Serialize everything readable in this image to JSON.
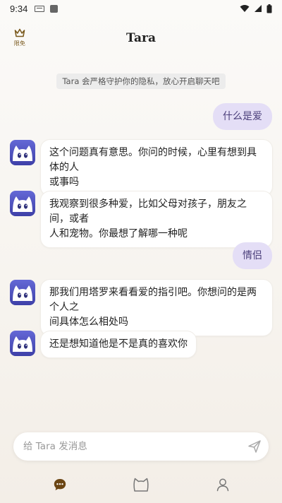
{
  "status_bar": {
    "time": "9:34"
  },
  "header": {
    "vip_label": "限免",
    "title": "Tara"
  },
  "privacy_notice": "Tara 会严格守护你的隐私，放心开启聊天吧",
  "messages": [
    {
      "role": "user",
      "text": "什么是爱"
    },
    {
      "role": "bot",
      "lines": [
        "这个问题真有意思。你问的时候，心里有想到具体的人",
        "或事吗"
      ]
    },
    {
      "role": "bot",
      "lines": [
        "我观察到很多种爱，比如父母对孩子，朋友之间，或者",
        "人和宠物。你最想了解哪一种呢"
      ]
    },
    {
      "role": "user",
      "text": "情侣"
    },
    {
      "role": "bot",
      "lines": [
        "那我们用塔罗来看看爱的指引吧。你想问的是两个人之",
        "间具体怎么相处吗"
      ]
    },
    {
      "role": "bot",
      "lines": [
        "还是想知道他是不是真的喜欢你"
      ]
    }
  ],
  "input": {
    "placeholder": "给 Tara 发消息"
  },
  "colors": {
    "accent_brown": "#7a5a1e",
    "user_bubble": "#e4def6",
    "user_text": "#4a3e7a",
    "avatar_bg": "#4b4ec0"
  },
  "icons": {
    "vip": "crown-icon",
    "send": "send-icon",
    "nav_chat": "chat-bubble-icon",
    "nav_cat": "cat-face-icon",
    "nav_profile": "person-icon"
  }
}
